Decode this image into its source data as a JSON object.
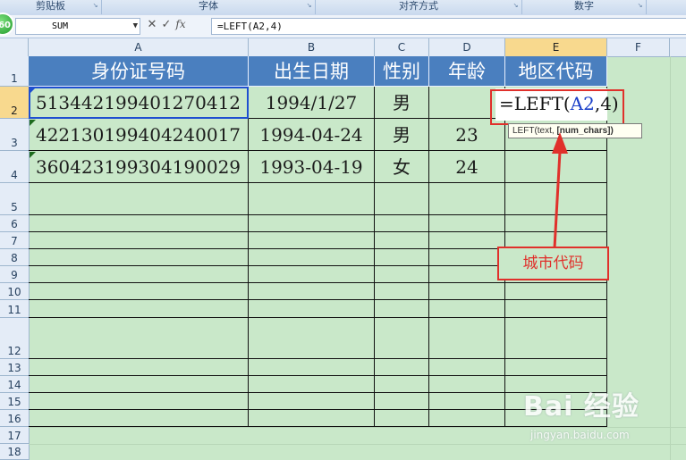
{
  "ribbon": {
    "groups": [
      "剪贴板",
      "字体",
      "对齐方式",
      "数字"
    ]
  },
  "badge": "60",
  "formula_bar": {
    "name_box": "SUM",
    "cancel_icon": "✕",
    "enter_icon": "✓",
    "fx_label": "fx",
    "formula": "=LEFT(A2,4)"
  },
  "columns": [
    "A",
    "B",
    "C",
    "D",
    "E",
    "F"
  ],
  "rows": [
    "1",
    "2",
    "3",
    "4",
    "5",
    "6",
    "7",
    "8",
    "9",
    "10",
    "11",
    "12",
    "13",
    "14",
    "15",
    "16",
    "17",
    "18"
  ],
  "table": {
    "headers": [
      "身份证号码",
      "出生日期",
      "性别",
      "年龄",
      "地区代码"
    ],
    "records": [
      [
        "513442199401270412",
        "1994/1/27",
        "男",
        "",
        ""
      ],
      [
        "422130199404240017",
        "1994-04-24",
        "男",
        "23",
        ""
      ],
      [
        "360423199304190029",
        "1993-04-19",
        "女",
        "24",
        ""
      ]
    ]
  },
  "edit_cell": {
    "prefix": "=LEFT(",
    "ref": "A2",
    "suffix": ",4)"
  },
  "tooltip": {
    "func": "LEFT(text,",
    "arg": "[num_chars])"
  },
  "annotation": "城市代码",
  "watermark": {
    "logo": "Bai 经验",
    "url": "jingyan.baidu.com"
  },
  "colors": {
    "header_fill": "#4a7fbf",
    "sheet_bg": "#c9e8c9",
    "highlight_red": "#e0302b",
    "selection_blue": "#1e4fd0"
  }
}
